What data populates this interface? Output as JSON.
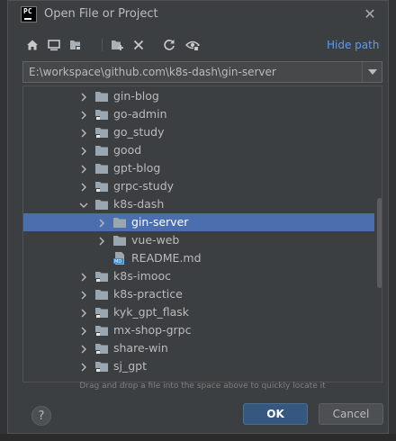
{
  "window": {
    "title": "Open File or Project",
    "app_icon": "pycharm-logo",
    "app_icon_text": "PC"
  },
  "toolbar": {
    "buttons": [
      {
        "icon": "home-icon"
      },
      {
        "icon": "desktop-icon"
      },
      {
        "icon": "project-folder-icon"
      },
      {
        "icon": "new-folder-icon"
      },
      {
        "icon": "delete-icon"
      },
      {
        "icon": "refresh-icon"
      },
      {
        "icon": "show-hidden-icon"
      }
    ],
    "hide_path_label": "Hide path"
  },
  "path": {
    "value": "E:\\workspace\\github.com\\k8s-dash\\gin-server"
  },
  "tree": {
    "items": [
      {
        "label": "gin-blog",
        "type": "folder",
        "expanded": false
      },
      {
        "label": "go-admin",
        "type": "project-folder",
        "expanded": false
      },
      {
        "label": "go_study",
        "type": "project-folder",
        "expanded": false
      },
      {
        "label": "good",
        "type": "folder",
        "expanded": false
      },
      {
        "label": "gpt-blog",
        "type": "folder",
        "expanded": false
      },
      {
        "label": "grpc-study",
        "type": "project-folder",
        "expanded": false
      },
      {
        "label": "k8s-dash",
        "type": "folder",
        "expanded": true
      },
      {
        "label": "gin-server",
        "type": "folder",
        "expanded": false,
        "selected": true
      },
      {
        "label": "vue-web",
        "type": "folder",
        "expanded": false
      },
      {
        "label": "README.md",
        "type": "markdown-file"
      },
      {
        "label": "k8s-imooc",
        "type": "project-folder",
        "expanded": false
      },
      {
        "label": "k8s-practice",
        "type": "folder",
        "expanded": false
      },
      {
        "label": "kyk_gpt_flask",
        "type": "project-folder",
        "expanded": false
      },
      {
        "label": "mx-shop-grpc",
        "type": "project-folder",
        "expanded": false
      },
      {
        "label": "share-win",
        "type": "project-folder",
        "expanded": false
      },
      {
        "label": "sj_gpt",
        "type": "project-folder",
        "expanded": false
      }
    ]
  },
  "hint": "Drag and drop a file into the space above to quickly locate it",
  "buttons": {
    "help": "?",
    "ok": "OK",
    "cancel": "Cancel"
  },
  "colors": {
    "dialog_bg": "#3c3f41",
    "selection": "#4b6eaf",
    "link": "#589df6",
    "ok_bg": "#365880",
    "folder": "#9aa7b0"
  }
}
